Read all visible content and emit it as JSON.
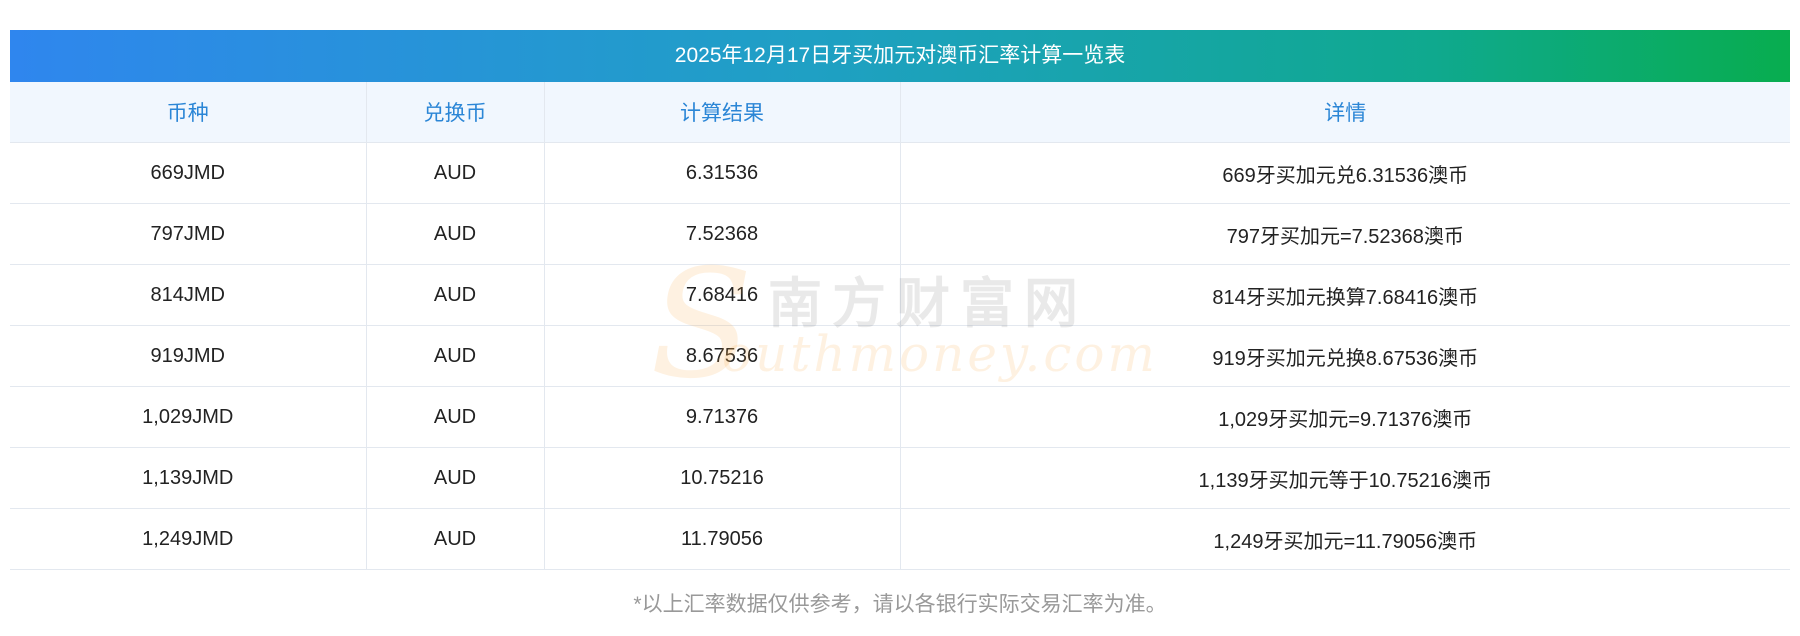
{
  "title": "2025年12月17日牙买加元对澳币汇率计算一览表",
  "headers": {
    "currency": "币种",
    "target": "兑换币",
    "result": "计算结果",
    "detail": "详情"
  },
  "rows": [
    {
      "currency": "669JMD",
      "target": "AUD",
      "result": "6.31536",
      "detail": "669牙买加元兑6.31536澳币"
    },
    {
      "currency": "797JMD",
      "target": "AUD",
      "result": "7.52368",
      "detail": "797牙买加元=7.52368澳币"
    },
    {
      "currency": "814JMD",
      "target": "AUD",
      "result": "7.68416",
      "detail": "814牙买加元换算7.68416澳币"
    },
    {
      "currency": "919JMD",
      "target": "AUD",
      "result": "8.67536",
      "detail": "919牙买加元兑换8.67536澳币"
    },
    {
      "currency": "1,029JMD",
      "target": "AUD",
      "result": "9.71376",
      "detail": "1,029牙买加元=9.71376澳币"
    },
    {
      "currency": "1,139JMD",
      "target": "AUD",
      "result": "10.75216",
      "detail": "1,139牙买加元等于10.75216澳币"
    },
    {
      "currency": "1,249JMD",
      "target": "AUD",
      "result": "11.79056",
      "detail": "1,249牙买加元=11.79056澳币"
    }
  ],
  "watermark": {
    "initial": "S",
    "cn": "南方财富网",
    "en": "outhmoney.com"
  },
  "footnote": "*以上汇率数据仅供参考，请以各银行实际交易汇率为准。",
  "colors": {
    "title_gradient_start": "#2f86ee",
    "title_gradient_end": "#08ad4f",
    "header_text": "#2b86d6",
    "header_bg": "#f1f7fe"
  }
}
